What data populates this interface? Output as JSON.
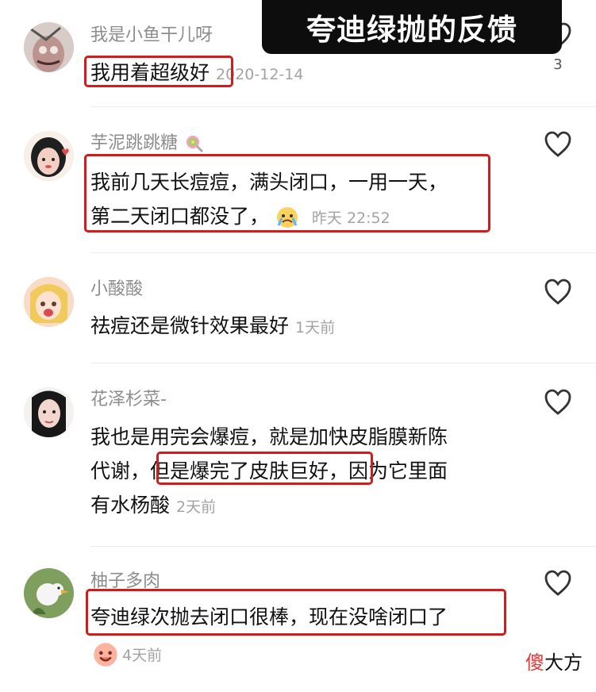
{
  "banner": {
    "title": "夸迪绿抛的反馈"
  },
  "comments": [
    {
      "username": "我是小鱼干儿呀",
      "text_lines": [
        "我用着超级好"
      ],
      "time": "2020-12-14",
      "likes": "3"
    },
    {
      "username": "芋泥跳跳糖",
      "text_lines": [
        "我前几天长痘痘，满头闭口，一用一天，",
        "第二天闭口都没了，"
      ],
      "time": "昨天 22:52",
      "likes": ""
    },
    {
      "username": "小酸酸",
      "text_lines": [
        "祛痘还是微针效果最好"
      ],
      "time": "1天前",
      "likes": ""
    },
    {
      "username": "花泽杉菜-",
      "text_lines": [
        "我也是用完会爆痘，就是加快皮脂膜新陈",
        "代谢，但是爆完了皮肤巨好，因为它里面",
        "有水杨酸"
      ],
      "time": "2天前",
      "likes": ""
    },
    {
      "username": "柚子多肉",
      "text_lines": [
        "夸迪绿次抛去闭口很棒，现在没啥闭口了"
      ],
      "time": "4天前",
      "likes": ""
    }
  ],
  "watermark": {
    "first": "傻",
    "rest": "大方"
  },
  "icons": {
    "like": "heart-outline-icon",
    "avatar": "avatar",
    "emoji": "emoji-icon"
  },
  "colors": {
    "highlight": "#d11c1c",
    "username": "#8d8d8d",
    "text": "#111111",
    "timestamp": "#a3a3a3",
    "banner_bg": "#0d0d0d"
  }
}
